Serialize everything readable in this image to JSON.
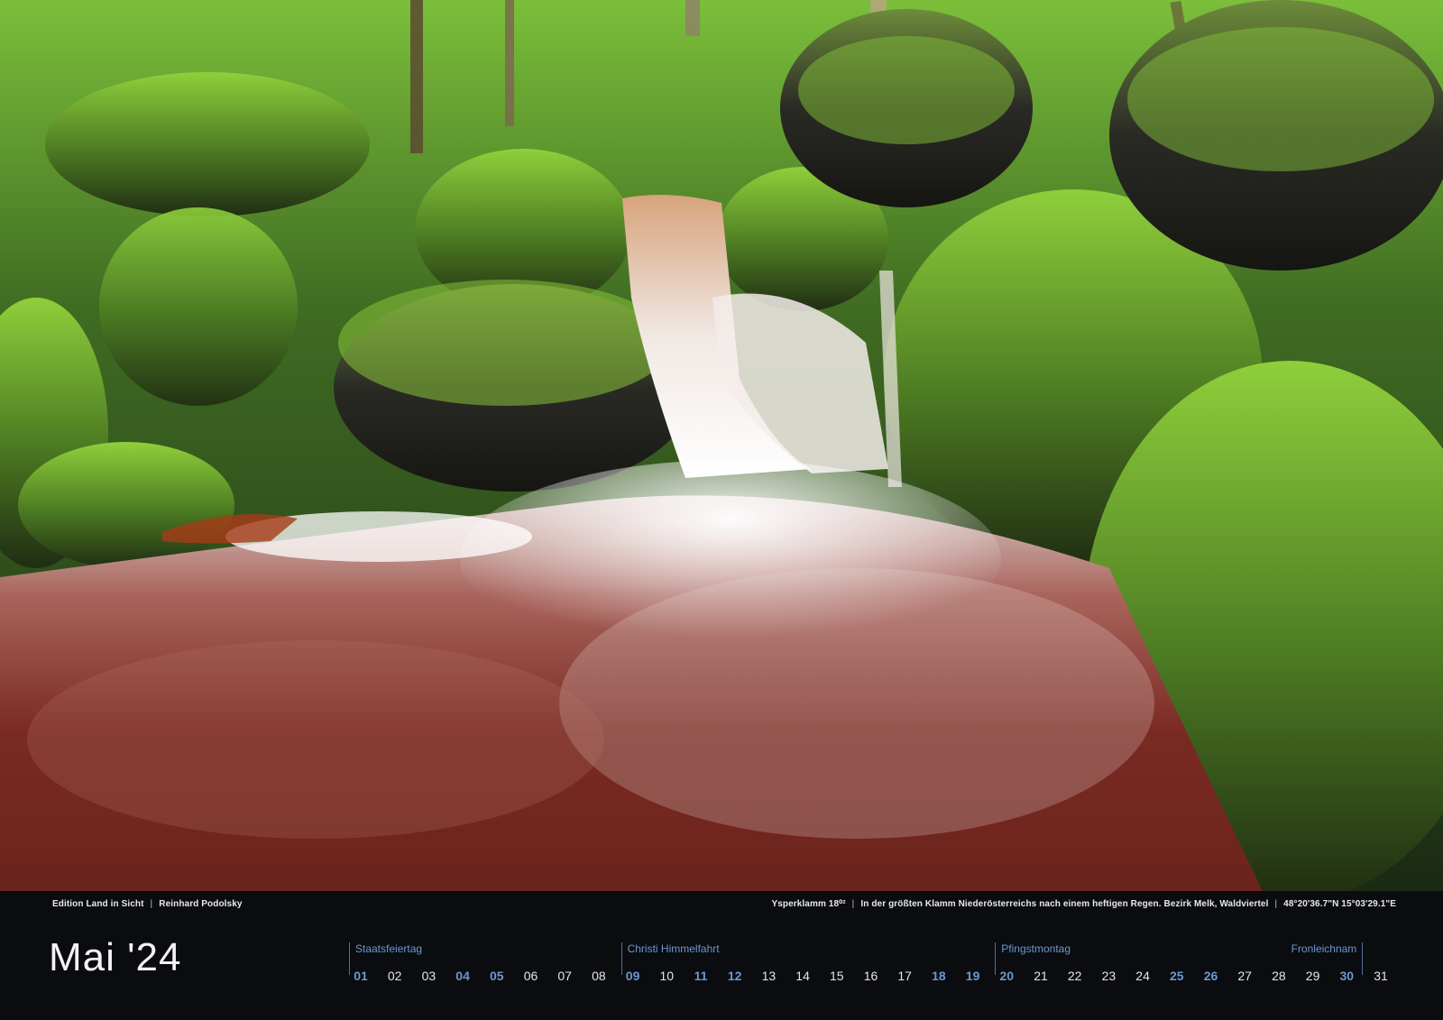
{
  "credits": {
    "edition": "Edition Land in Sicht",
    "photographer": "Reinhard Podolsky",
    "location": "Ysperklamm 18⁰²",
    "description": "In der größten Klamm Niederösterreichs nach einem heftigen Regen. Bezirk Melk, Waldviertel",
    "coordinates": "48°20'36.7\"N 15°03'29.1\"E",
    "separator": "|"
  },
  "calendar": {
    "month_label": "Mai '24",
    "days": [
      "01",
      "02",
      "03",
      "04",
      "05",
      "06",
      "07",
      "08",
      "09",
      "10",
      "11",
      "12",
      "13",
      "14",
      "15",
      "16",
      "17",
      "18",
      "19",
      "20",
      "21",
      "22",
      "23",
      "24",
      "25",
      "26",
      "27",
      "28",
      "29",
      "30",
      "31"
    ],
    "highlighted_days": [
      "01",
      "04",
      "05",
      "09",
      "11",
      "12",
      "18",
      "19",
      "20",
      "25",
      "26",
      "30"
    ],
    "notes": [
      {
        "day": "01",
        "label": "Staatsfeiertag"
      },
      {
        "day": "09",
        "label": "Christi Himmelfahrt"
      },
      {
        "day": "20",
        "label": "Pfingstmontag"
      },
      {
        "day": "30",
        "label": "Fronleichnam"
      }
    ],
    "accent_color": "#6d97cf"
  },
  "photo": {
    "subject": "waterfall-in-mossy-forest"
  }
}
